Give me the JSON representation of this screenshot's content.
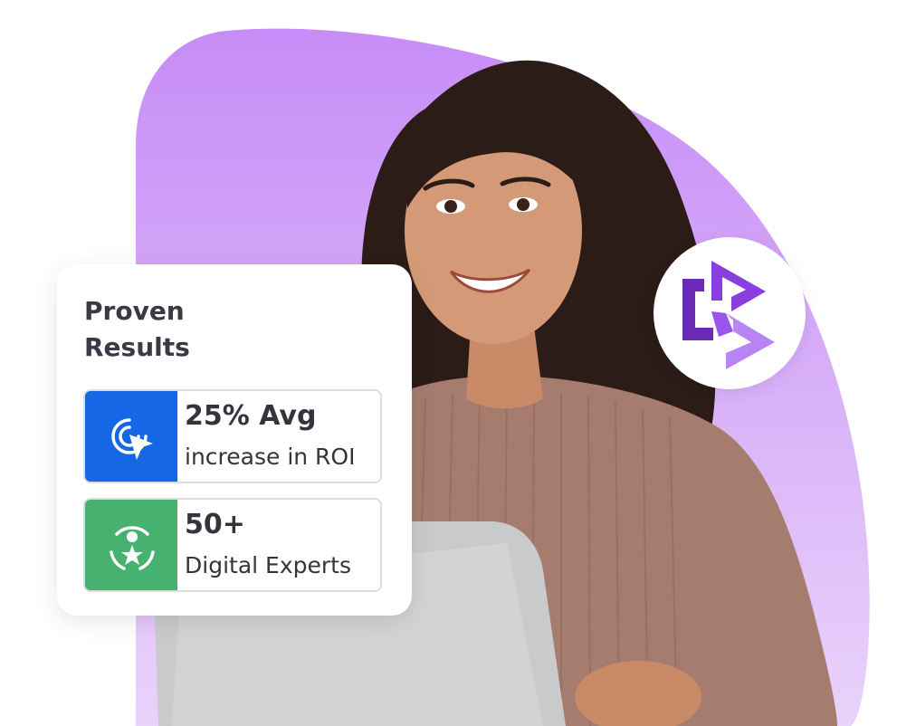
{
  "colors": {
    "blob_top": "#c990f8",
    "blob_bottom": "#e6cef9",
    "roi_icon_bg": "#1567e6",
    "experts_icon_bg": "#47b26f",
    "logo_dark": "#6a2bb8",
    "logo_light": "#b785f4",
    "title_text": "#3a3a44"
  },
  "card": {
    "title": "Proven Results",
    "stats": [
      {
        "value": "25% Avg",
        "description": "increase in ROI",
        "icon": "cursor-click-icon"
      },
      {
        "value": "50+",
        "description": "Digital Experts",
        "icon": "expert-star-icon"
      }
    ]
  },
  "logo": {
    "icon": "brand-logo-icon"
  },
  "photo": {
    "subject": "person-with-laptop-illustration"
  }
}
